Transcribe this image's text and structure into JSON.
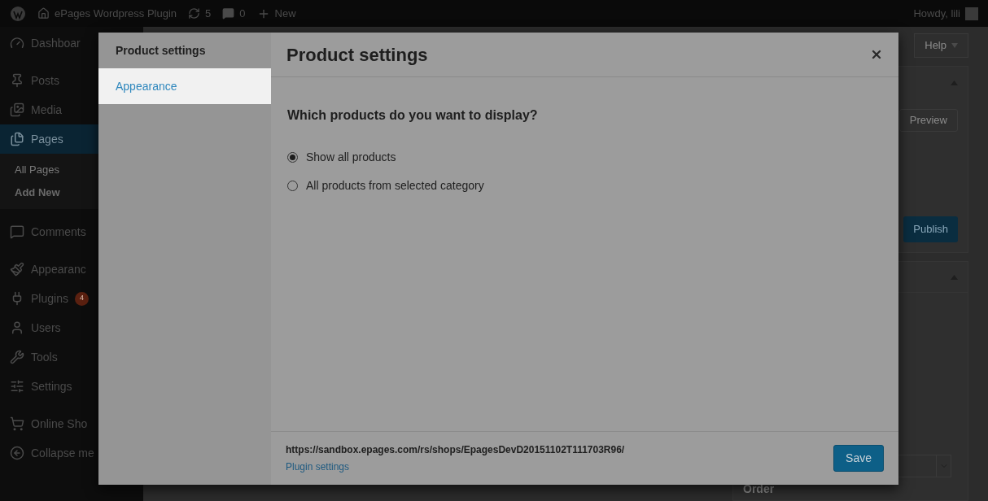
{
  "admin_bar": {
    "site_name": "ePages Wordpress Plugin",
    "updates": "5",
    "comments": "0",
    "new": "New",
    "greeting": "Howdy, lili"
  },
  "admin_menu": [
    {
      "label": "Dashboar",
      "current": false
    },
    {
      "label": "Posts",
      "current": false
    },
    {
      "label": "Media",
      "current": false
    },
    {
      "label": "Pages",
      "current": true,
      "children": [
        {
          "label": "All Pages",
          "selected": false
        },
        {
          "label": "Add New",
          "selected": true
        }
      ]
    },
    {
      "label": "Comments",
      "current": false
    },
    {
      "label": "Appearanc",
      "current": false
    },
    {
      "label": "Plugins",
      "current": false,
      "badge": "4"
    },
    {
      "label": "Users",
      "current": false
    },
    {
      "label": "Tools",
      "current": false
    },
    {
      "label": "Settings",
      "current": false
    },
    {
      "label": "Online Sho",
      "current": false
    },
    {
      "label": "Collapse me",
      "current": false
    }
  ],
  "page_side": {
    "help": "Help",
    "preview": "Preview",
    "publish": "Publish",
    "order": "Order"
  },
  "modal": {
    "menu": [
      {
        "label": "Product settings",
        "selected": true,
        "hovered": false
      },
      {
        "label": "Appearance",
        "selected": false,
        "hovered": true
      }
    ],
    "title": "Product settings",
    "question": "Which products do you want to display?",
    "options": [
      {
        "label": "Show all products",
        "selected": true
      },
      {
        "label": "All products from selected category",
        "selected": false
      }
    ],
    "shop_url": "https://sandbox.epages.com/rs/shops/EpagesDevD20151102T111703R96/",
    "settings_link": "Plugin settings",
    "save": "Save"
  }
}
